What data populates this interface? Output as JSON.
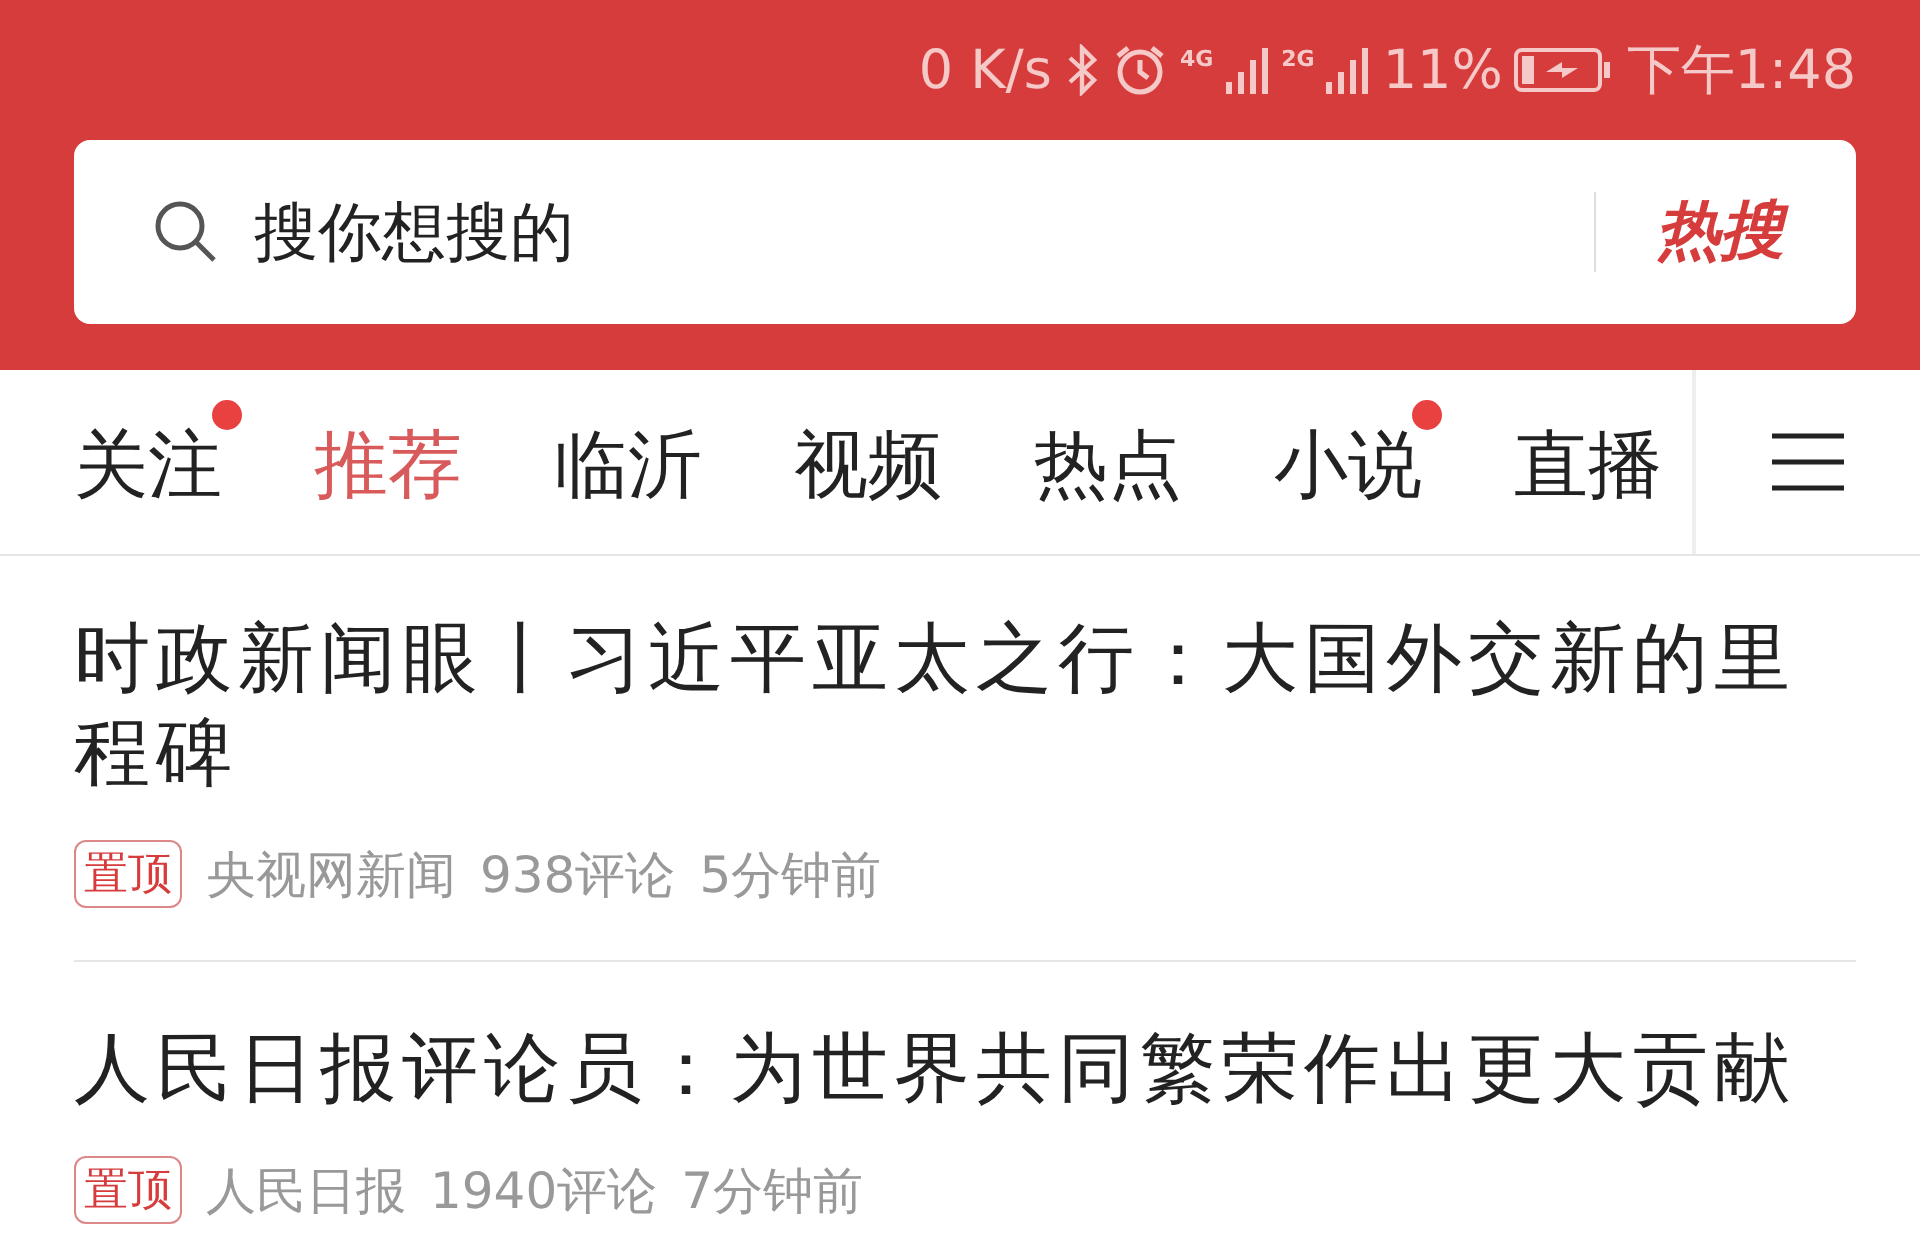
{
  "status_bar": {
    "speed": "0 K/s",
    "net1": "4G",
    "net2": "2G",
    "battery": "11%",
    "time": "下午1:48"
  },
  "search": {
    "placeholder": "搜你想搜的",
    "hot_button": "热搜"
  },
  "tabs": [
    {
      "label": "关注",
      "selected": false,
      "dot": true
    },
    {
      "label": "推荐",
      "selected": true,
      "dot": false
    },
    {
      "label": "临沂",
      "selected": false,
      "dot": false
    },
    {
      "label": "视频",
      "selected": false,
      "dot": false
    },
    {
      "label": "热点",
      "selected": false,
      "dot": false
    },
    {
      "label": "小说",
      "selected": false,
      "dot": true
    },
    {
      "label": "直播",
      "selected": false,
      "dot": false
    }
  ],
  "articles": [
    {
      "title": "时政新闻眼丨习近平亚太之行：大国外交新的里程碑",
      "tag": "置顶",
      "source": "央视网新闻",
      "comments": "938评论",
      "time": "5分钟前"
    },
    {
      "title": "人民日报评论员：为世界共同繁荣作出更大贡献",
      "tag": "置顶",
      "source": "人民日报",
      "comments": "1940评论",
      "time": "7分钟前"
    }
  ]
}
